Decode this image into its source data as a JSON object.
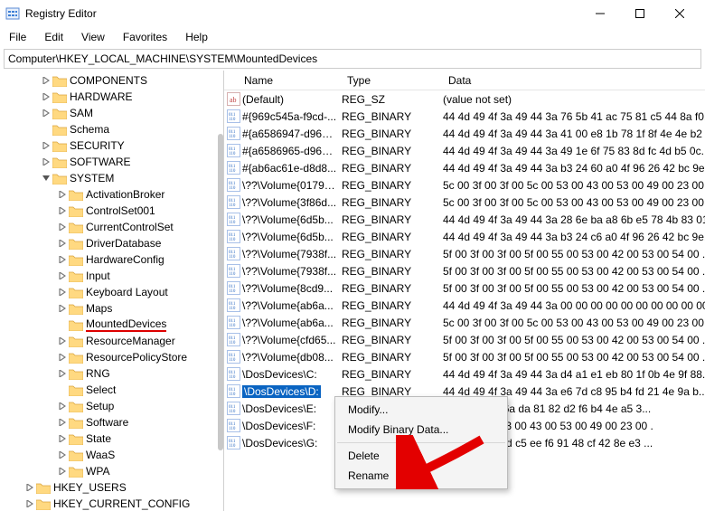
{
  "window": {
    "title": "Registry Editor"
  },
  "menu": {
    "file": "File",
    "edit": "Edit",
    "view": "View",
    "favorites": "Favorites",
    "help": "Help"
  },
  "address": "Computer\\HKEY_LOCAL_MACHINE\\SYSTEM\\MountedDevices",
  "tree": {
    "items": [
      {
        "indent": 2,
        "tw": "r",
        "label": "COMPONENTS"
      },
      {
        "indent": 2,
        "tw": "r",
        "label": "HARDWARE"
      },
      {
        "indent": 2,
        "tw": "r",
        "label": "SAM"
      },
      {
        "indent": 2,
        "tw": "",
        "label": "Schema"
      },
      {
        "indent": 2,
        "tw": "r",
        "label": "SECURITY"
      },
      {
        "indent": 2,
        "tw": "r",
        "label": "SOFTWARE"
      },
      {
        "indent": 2,
        "tw": "d",
        "label": "SYSTEM"
      },
      {
        "indent": 3,
        "tw": "r",
        "label": "ActivationBroker"
      },
      {
        "indent": 3,
        "tw": "r",
        "label": "ControlSet001"
      },
      {
        "indent": 3,
        "tw": "r",
        "label": "CurrentControlSet"
      },
      {
        "indent": 3,
        "tw": "r",
        "label": "DriverDatabase"
      },
      {
        "indent": 3,
        "tw": "r",
        "label": "HardwareConfig"
      },
      {
        "indent": 3,
        "tw": "r",
        "label": "Input"
      },
      {
        "indent": 3,
        "tw": "r",
        "label": "Keyboard Layout"
      },
      {
        "indent": 3,
        "tw": "r",
        "label": "Maps"
      },
      {
        "indent": 3,
        "tw": "",
        "label": "MountedDevices",
        "selected": true
      },
      {
        "indent": 3,
        "tw": "r",
        "label": "ResourceManager"
      },
      {
        "indent": 3,
        "tw": "r",
        "label": "ResourcePolicyStore"
      },
      {
        "indent": 3,
        "tw": "r",
        "label": "RNG"
      },
      {
        "indent": 3,
        "tw": "",
        "label": "Select"
      },
      {
        "indent": 3,
        "tw": "r",
        "label": "Setup"
      },
      {
        "indent": 3,
        "tw": "r",
        "label": "Software"
      },
      {
        "indent": 3,
        "tw": "r",
        "label": "State"
      },
      {
        "indent": 3,
        "tw": "r",
        "label": "WaaS"
      },
      {
        "indent": 3,
        "tw": "r",
        "label": "WPA"
      },
      {
        "indent": 1,
        "tw": "r",
        "label": "HKEY_USERS"
      },
      {
        "indent": 1,
        "tw": "r",
        "label": "HKEY_CURRENT_CONFIG"
      }
    ]
  },
  "list": {
    "headers": {
      "name": "Name",
      "type": "Type",
      "data": "Data"
    },
    "rows": [
      {
        "icon": "sz",
        "name": "(Default)",
        "type": "REG_SZ",
        "data": "(value not set)"
      },
      {
        "icon": "bin",
        "name": "#{969c545a-f9cd-...",
        "type": "REG_BINARY",
        "data": "44 4d 49 4f 3a 49 44 3a 76 5b 41 ac 75 81 c5 44 8a f0."
      },
      {
        "icon": "bin",
        "name": "#{a6586947-d96e-...",
        "type": "REG_BINARY",
        "data": "44 4d 49 4f 3a 49 44 3a 41 00 e8 1b 78 1f 8f 4e 4e b2 2f ."
      },
      {
        "icon": "bin",
        "name": "#{a6586965-d96e-...",
        "type": "REG_BINARY",
        "data": "44 4d 49 4f 3a 49 44 3a 49 1e 6f 75 83 8d fc 4d b5 0c."
      },
      {
        "icon": "bin",
        "name": "#{ab6ac61e-d8d8...",
        "type": "REG_BINARY",
        "data": "44 4d 49 4f 3a 49 44 3a b3 24 60 a0 4f 96 26 42 bc 9e."
      },
      {
        "icon": "bin",
        "name": "\\??\\Volume{0179a...",
        "type": "REG_BINARY",
        "data": "5c 00 3f 00 3f 00 5c 00 53 00 43 00 53 00 49 00 23 00 ."
      },
      {
        "icon": "bin",
        "name": "\\??\\Volume{3f86d...",
        "type": "REG_BINARY",
        "data": "5c 00 3f 00 3f 00 5c 00 53 00 43 00 53 00 49 00 23 00 ."
      },
      {
        "icon": "bin",
        "name": "\\??\\Volume{6d5b...",
        "type": "REG_BINARY",
        "data": "44 4d 49 4f 3a 49 44 3a 28 6e ba a8 6b e5 78 4b 83 01 ."
      },
      {
        "icon": "bin",
        "name": "\\??\\Volume{6d5b...",
        "type": "REG_BINARY",
        "data": "44 4d 49 4f 3a 49 44 3a b3 24 c6 a0 4f 96 26 42 bc 9e."
      },
      {
        "icon": "bin",
        "name": "\\??\\Volume{7938f...",
        "type": "REG_BINARY",
        "data": "5f 00 3f 00 3f 00 5f 00 55 00 53 00 42 00 53 00 54 00 ..."
      },
      {
        "icon": "bin",
        "name": "\\??\\Volume{7938f...",
        "type": "REG_BINARY",
        "data": "5f 00 3f 00 3f 00 5f 00 55 00 53 00 42 00 53 00 54 00 ..."
      },
      {
        "icon": "bin",
        "name": "\\??\\Volume{8cd9...",
        "type": "REG_BINARY",
        "data": "5f 00 3f 00 3f 00 5f 00 55 00 53 00 42 00 53 00 54 00 ..."
      },
      {
        "icon": "bin",
        "name": "\\??\\Volume{ab6a...",
        "type": "REG_BINARY",
        "data": "44 4d 49 4f 3a 49 44 3a 00 00 00 00 00 00 00 00 00 00 ..."
      },
      {
        "icon": "bin",
        "name": "\\??\\Volume{ab6a...",
        "type": "REG_BINARY",
        "data": "5c 00 3f 00 3f 00 5c 00 53 00 43 00 53 00 49 00 23 00 ."
      },
      {
        "icon": "bin",
        "name": "\\??\\Volume{cfd65...",
        "type": "REG_BINARY",
        "data": "5f 00 3f 00 3f 00 5f 00 55 00 53 00 42 00 53 00 54 00 ..."
      },
      {
        "icon": "bin",
        "name": "\\??\\Volume{db08...",
        "type": "REG_BINARY",
        "data": "5f 00 3f 00 3f 00 5f 00 55 00 53 00 42 00 53 00 54 00 ..."
      },
      {
        "icon": "bin",
        "name": "\\DosDevices\\C:",
        "type": "REG_BINARY",
        "data": "44 4d 49 4f 3a 49 44 3a d4 a1 e1 eb 80 1f 0b 4e 9f 88."
      },
      {
        "icon": "bin",
        "name": "\\DosDevices\\D:",
        "type": "REG_BINARY",
        "data": "44 4d 49 4f 3a 49 44 3a e6 7d c8 95 b4 fd 21 4e 9a b...",
        "selected": true
      },
      {
        "icon": "bin",
        "name": "\\DosDevices\\E:",
        "type": "REG_BINARY",
        "data": "3a 49 44 3a 6a da 81 82 d2 f6 b4 4e a5 3..."
      },
      {
        "icon": "bin",
        "name": "\\DosDevices\\F:",
        "type": "REG_BINARY",
        "data": "3f 00 5c 00 53 00 43 00 53 00 49 00 23 00 ."
      },
      {
        "icon": "bin",
        "name": "\\DosDevices\\G:",
        "type": "REG_BINARY",
        "data": "3a 49 44 3a fd c5 ee f6 91 48 cf 42 8e e3 ..."
      }
    ]
  },
  "context_menu": {
    "modify": "Modify...",
    "modify_binary": "Modify Binary Data...",
    "delete": "Delete",
    "rename": "Rename"
  }
}
